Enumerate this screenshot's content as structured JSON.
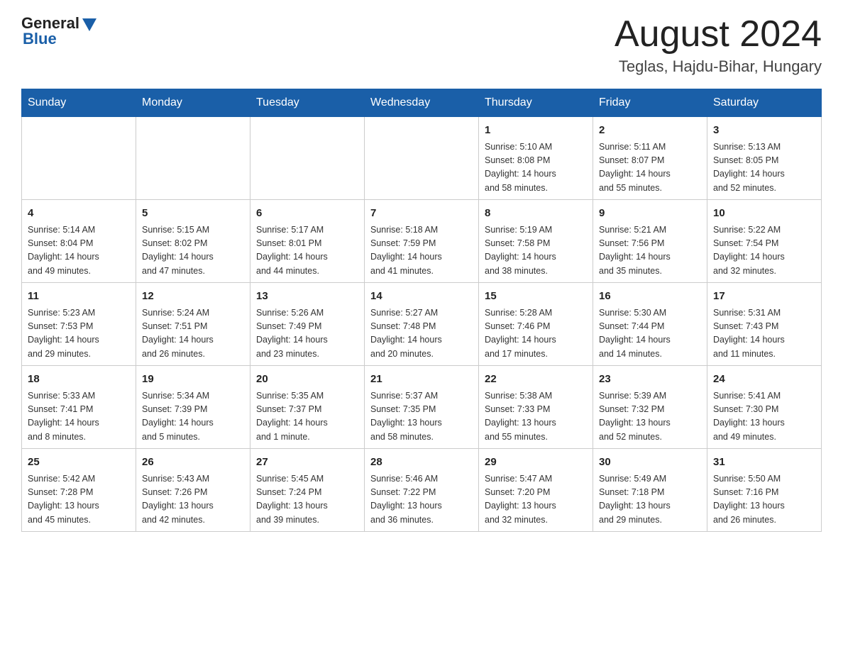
{
  "header": {
    "logo_general": "General",
    "logo_blue": "Blue",
    "month_title": "August 2024",
    "location": "Teglas, Hajdu-Bihar, Hungary"
  },
  "days_of_week": [
    "Sunday",
    "Monday",
    "Tuesday",
    "Wednesday",
    "Thursday",
    "Friday",
    "Saturday"
  ],
  "weeks": [
    [
      {
        "day": "",
        "info": ""
      },
      {
        "day": "",
        "info": ""
      },
      {
        "day": "",
        "info": ""
      },
      {
        "day": "",
        "info": ""
      },
      {
        "day": "1",
        "info": "Sunrise: 5:10 AM\nSunset: 8:08 PM\nDaylight: 14 hours\nand 58 minutes."
      },
      {
        "day": "2",
        "info": "Sunrise: 5:11 AM\nSunset: 8:07 PM\nDaylight: 14 hours\nand 55 minutes."
      },
      {
        "day": "3",
        "info": "Sunrise: 5:13 AM\nSunset: 8:05 PM\nDaylight: 14 hours\nand 52 minutes."
      }
    ],
    [
      {
        "day": "4",
        "info": "Sunrise: 5:14 AM\nSunset: 8:04 PM\nDaylight: 14 hours\nand 49 minutes."
      },
      {
        "day": "5",
        "info": "Sunrise: 5:15 AM\nSunset: 8:02 PM\nDaylight: 14 hours\nand 47 minutes."
      },
      {
        "day": "6",
        "info": "Sunrise: 5:17 AM\nSunset: 8:01 PM\nDaylight: 14 hours\nand 44 minutes."
      },
      {
        "day": "7",
        "info": "Sunrise: 5:18 AM\nSunset: 7:59 PM\nDaylight: 14 hours\nand 41 minutes."
      },
      {
        "day": "8",
        "info": "Sunrise: 5:19 AM\nSunset: 7:58 PM\nDaylight: 14 hours\nand 38 minutes."
      },
      {
        "day": "9",
        "info": "Sunrise: 5:21 AM\nSunset: 7:56 PM\nDaylight: 14 hours\nand 35 minutes."
      },
      {
        "day": "10",
        "info": "Sunrise: 5:22 AM\nSunset: 7:54 PM\nDaylight: 14 hours\nand 32 minutes."
      }
    ],
    [
      {
        "day": "11",
        "info": "Sunrise: 5:23 AM\nSunset: 7:53 PM\nDaylight: 14 hours\nand 29 minutes."
      },
      {
        "day": "12",
        "info": "Sunrise: 5:24 AM\nSunset: 7:51 PM\nDaylight: 14 hours\nand 26 minutes."
      },
      {
        "day": "13",
        "info": "Sunrise: 5:26 AM\nSunset: 7:49 PM\nDaylight: 14 hours\nand 23 minutes."
      },
      {
        "day": "14",
        "info": "Sunrise: 5:27 AM\nSunset: 7:48 PM\nDaylight: 14 hours\nand 20 minutes."
      },
      {
        "day": "15",
        "info": "Sunrise: 5:28 AM\nSunset: 7:46 PM\nDaylight: 14 hours\nand 17 minutes."
      },
      {
        "day": "16",
        "info": "Sunrise: 5:30 AM\nSunset: 7:44 PM\nDaylight: 14 hours\nand 14 minutes."
      },
      {
        "day": "17",
        "info": "Sunrise: 5:31 AM\nSunset: 7:43 PM\nDaylight: 14 hours\nand 11 minutes."
      }
    ],
    [
      {
        "day": "18",
        "info": "Sunrise: 5:33 AM\nSunset: 7:41 PM\nDaylight: 14 hours\nand 8 minutes."
      },
      {
        "day": "19",
        "info": "Sunrise: 5:34 AM\nSunset: 7:39 PM\nDaylight: 14 hours\nand 5 minutes."
      },
      {
        "day": "20",
        "info": "Sunrise: 5:35 AM\nSunset: 7:37 PM\nDaylight: 14 hours\nand 1 minute."
      },
      {
        "day": "21",
        "info": "Sunrise: 5:37 AM\nSunset: 7:35 PM\nDaylight: 13 hours\nand 58 minutes."
      },
      {
        "day": "22",
        "info": "Sunrise: 5:38 AM\nSunset: 7:33 PM\nDaylight: 13 hours\nand 55 minutes."
      },
      {
        "day": "23",
        "info": "Sunrise: 5:39 AM\nSunset: 7:32 PM\nDaylight: 13 hours\nand 52 minutes."
      },
      {
        "day": "24",
        "info": "Sunrise: 5:41 AM\nSunset: 7:30 PM\nDaylight: 13 hours\nand 49 minutes."
      }
    ],
    [
      {
        "day": "25",
        "info": "Sunrise: 5:42 AM\nSunset: 7:28 PM\nDaylight: 13 hours\nand 45 minutes."
      },
      {
        "day": "26",
        "info": "Sunrise: 5:43 AM\nSunset: 7:26 PM\nDaylight: 13 hours\nand 42 minutes."
      },
      {
        "day": "27",
        "info": "Sunrise: 5:45 AM\nSunset: 7:24 PM\nDaylight: 13 hours\nand 39 minutes."
      },
      {
        "day": "28",
        "info": "Sunrise: 5:46 AM\nSunset: 7:22 PM\nDaylight: 13 hours\nand 36 minutes."
      },
      {
        "day": "29",
        "info": "Sunrise: 5:47 AM\nSunset: 7:20 PM\nDaylight: 13 hours\nand 32 minutes."
      },
      {
        "day": "30",
        "info": "Sunrise: 5:49 AM\nSunset: 7:18 PM\nDaylight: 13 hours\nand 29 minutes."
      },
      {
        "day": "31",
        "info": "Sunrise: 5:50 AM\nSunset: 7:16 PM\nDaylight: 13 hours\nand 26 minutes."
      }
    ]
  ]
}
